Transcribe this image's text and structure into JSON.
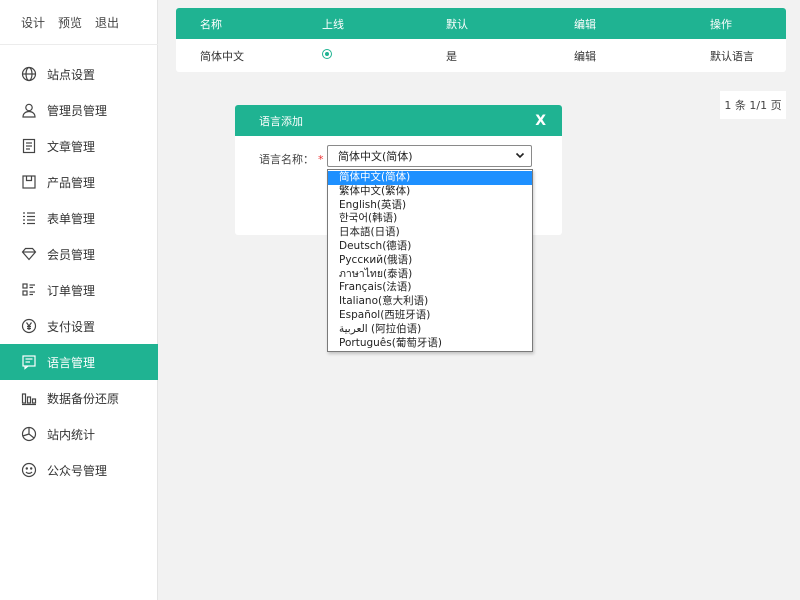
{
  "topnav": {
    "design": "设计",
    "preview": "预览",
    "logout": "退出"
  },
  "sidebar": {
    "items": [
      {
        "label": "站点设置",
        "icon": "globe-icon"
      },
      {
        "label": "管理员管理",
        "icon": "user-icon"
      },
      {
        "label": "文章管理",
        "icon": "document-icon"
      },
      {
        "label": "产品管理",
        "icon": "product-icon"
      },
      {
        "label": "表单管理",
        "icon": "list-icon"
      },
      {
        "label": "会员管理",
        "icon": "diamond-icon"
      },
      {
        "label": "订单管理",
        "icon": "order-icon"
      },
      {
        "label": "支付设置",
        "icon": "yen-icon"
      },
      {
        "label": "语言管理",
        "icon": "language-icon",
        "active": true
      },
      {
        "label": "数据备份还原",
        "icon": "bar-chart-icon"
      },
      {
        "label": "站内统计",
        "icon": "pie-chart-icon"
      },
      {
        "label": "公众号管理",
        "icon": "smiley-icon"
      }
    ]
  },
  "table": {
    "headers": [
      "名称",
      "上线",
      "默认",
      "编辑",
      "操作"
    ],
    "rows": [
      {
        "name": "简体中文",
        "online": true,
        "default": "是",
        "edit": "编辑",
        "action": "默认语言"
      }
    ]
  },
  "pager": {
    "text": "1 条 1/1 页"
  },
  "dialog": {
    "title": "语言添加",
    "close": "X",
    "field_label": "语言名称：",
    "required_mark": "*",
    "selected_value": "简体中文(简体)",
    "options": [
      "简体中文(简体)",
      "繁体中文(繁体)",
      "English(英语)",
      "한국어(韩语)",
      "日本語(日语)",
      "Deutsch(德语)",
      "Русский(俄语)",
      "ภาษาไทย(泰语)",
      "Français(法语)",
      "Italiano(意大利语)",
      "Español(西班牙语)",
      "العربية (阿拉伯语)",
      "Português(葡萄牙语)"
    ]
  },
  "colors": {
    "accent": "#1fb392",
    "selection": "#1e90ff"
  }
}
